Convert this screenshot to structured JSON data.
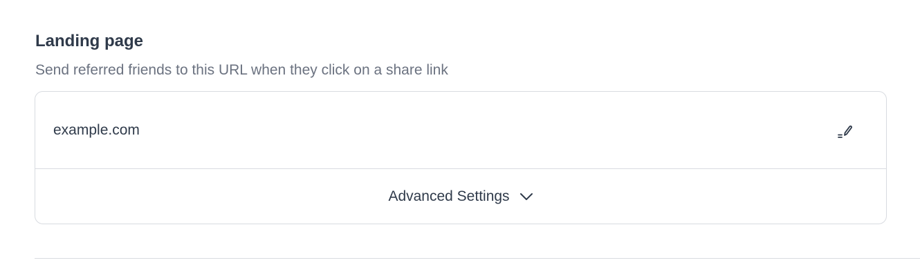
{
  "landing_page": {
    "title": "Landing page",
    "description": "Send referred friends to this URL when they click on a share link",
    "url_value": "example.com",
    "edit_icon": "pencil-edit-icon",
    "advanced_settings_label": "Advanced Settings",
    "advanced_settings_icon": "chevron-down-icon"
  },
  "colors": {
    "text_primary": "#2f3a4a",
    "text_secondary": "#6b7280",
    "border": "#d8dbe0",
    "background": "#ffffff"
  }
}
